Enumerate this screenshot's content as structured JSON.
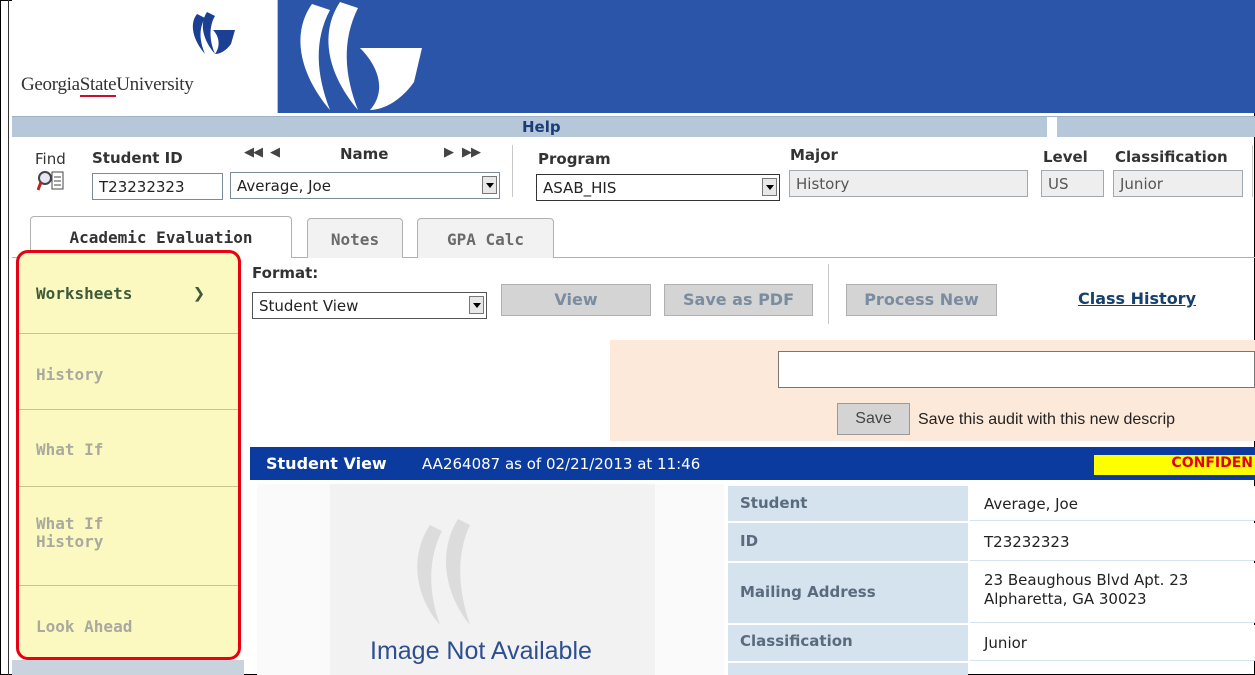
{
  "header": {
    "logo_text_a": "Georgia",
    "logo_text_b": "State",
    "logo_text_c": "University",
    "help_label": "Help",
    "brand_color": "#2a55a8"
  },
  "student_bar": {
    "find_label": "Find",
    "student_id_label": "Student ID",
    "student_id_value": "T23232323",
    "name_label": "Name",
    "name_value": "Average, Joe",
    "program_label": "Program",
    "program_value": "ASAB_HIS",
    "major_label": "Major",
    "major_value": "History",
    "level_label": "Level",
    "level_value": "US",
    "classification_label": "Classification",
    "classification_value": "Junior"
  },
  "tabs": [
    {
      "label": "Academic Evaluation"
    },
    {
      "label": "Notes"
    },
    {
      "label": "GPA Calc"
    }
  ],
  "sidebar": {
    "items": [
      {
        "label": "Worksheets"
      },
      {
        "label": "History"
      },
      {
        "label": "What If"
      },
      {
        "label": "What If History"
      },
      {
        "label": "Look Ahead"
      }
    ],
    "arrow": "❯"
  },
  "toolbar": {
    "format_label": "Format:",
    "format_value": "Student View",
    "view_label": "View",
    "save_pdf_label": "Save as PDF",
    "process_new_label": "Process New",
    "class_history_label": "Class History"
  },
  "save_audit": {
    "input_value": "",
    "save_label": "Save",
    "description": "Save this audit with this new descrip"
  },
  "student_view": {
    "title": "Student View",
    "audit_info": "AA264087 as of 02/21/2013 at 11:46",
    "confidential": "CONFIDEN",
    "image_na": "Image Not Available",
    "rows": [
      {
        "label": "Student",
        "value": "Average, Joe"
      },
      {
        "label": "ID",
        "value": "T23232323"
      },
      {
        "label": "Mailing Address",
        "value_line1": "23 Beaughous Blvd Apt. 23",
        "value_line2": "Alpharetta, GA 30023"
      },
      {
        "label": "Classification",
        "value": "Junior"
      }
    ]
  }
}
